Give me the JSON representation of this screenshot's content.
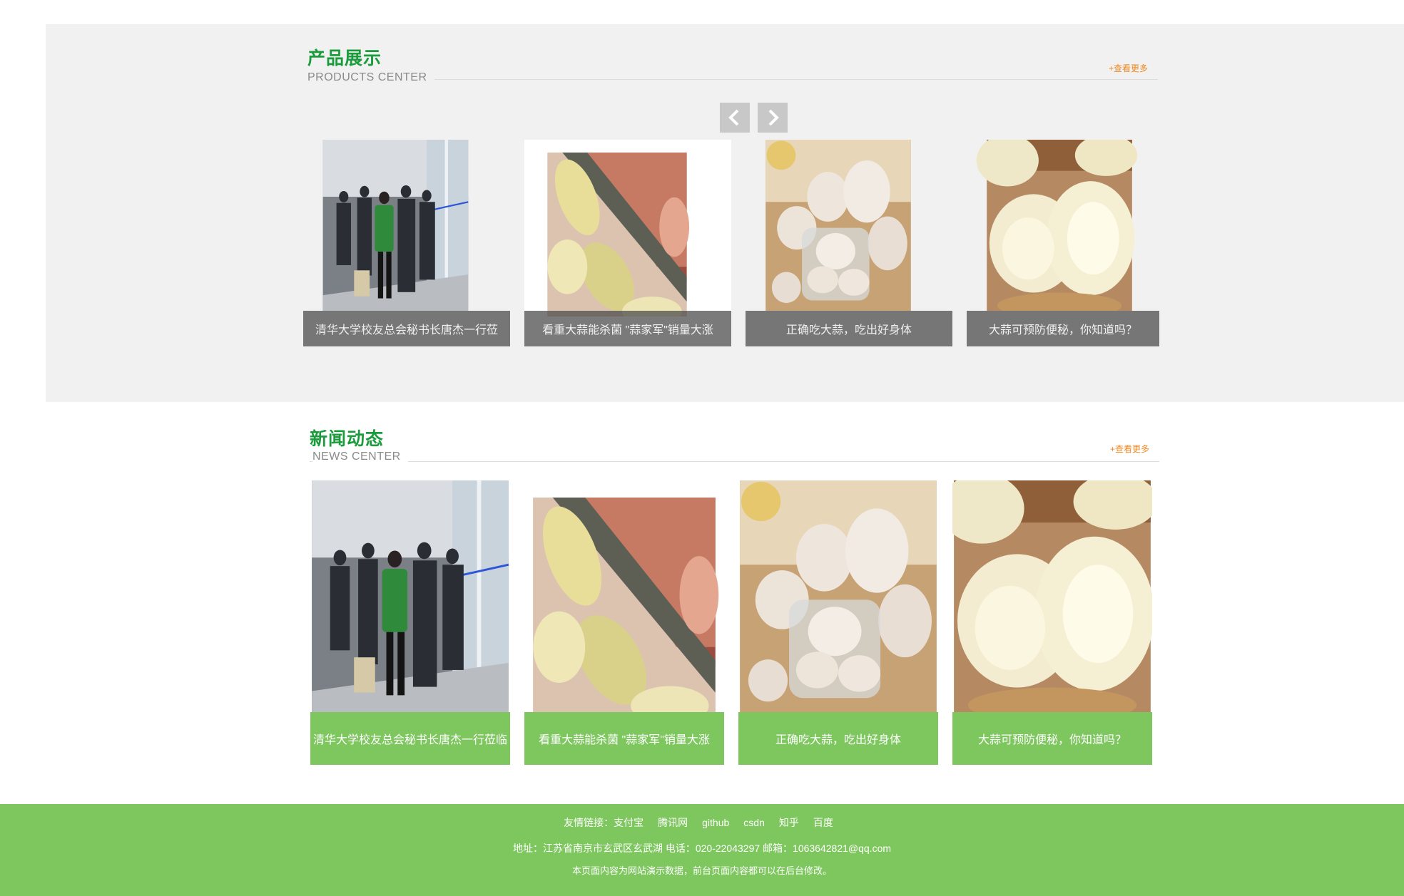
{
  "products": {
    "title": "产品展示",
    "subtitle": "PRODUCTS CENTER",
    "more": "+查看更多",
    "items": [
      {
        "caption": "清华大学校友总会秘书长唐杰一行莅",
        "image": "visit-photo"
      },
      {
        "caption": "看重大蒜能杀菌 \"蒜家军\"销量大涨",
        "image": "sliced-garlic"
      },
      {
        "caption": "正确吃大蒜，吃出好身体",
        "image": "garlic-bulbs"
      },
      {
        "caption": "大蒜可预防便秘，你知道吗？",
        "image": "peeled-garlic"
      }
    ]
  },
  "news": {
    "title": "新闻动态",
    "subtitle": "NEWS CENTER",
    "more": "+查看更多",
    "items": [
      {
        "caption": "清华大学校友总会秘书长唐杰一行莅临",
        "image": "visit-photo"
      },
      {
        "caption": "看重大蒜能杀菌 \"蒜家军\"销量大涨",
        "image": "sliced-garlic"
      },
      {
        "caption": "正确吃大蒜，吃出好身体",
        "image": "garlic-bulbs"
      },
      {
        "caption": "大蒜可预防便秘，你知道吗？",
        "image": "peeled-garlic"
      }
    ]
  },
  "footer": {
    "links_label": "友情链接：",
    "links": [
      "支付宝",
      "腾讯网",
      "github",
      "csdn",
      "知乎",
      "百度"
    ],
    "address": "地址：江苏省南京市玄武区玄武湖 电话：020-22043297 邮箱：1063642821@qq.com",
    "note": "本页面内容为网站演示数据，前台页面内容都可以在后台修改。"
  },
  "icons": {
    "prev": "chevron-left-icon",
    "next": "chevron-right-icon"
  },
  "colors": {
    "accent_green": "#1a9c3c",
    "footer_green": "#7dc75e",
    "more_orange": "#f08a24",
    "band_gray": "#f1f1f1"
  }
}
